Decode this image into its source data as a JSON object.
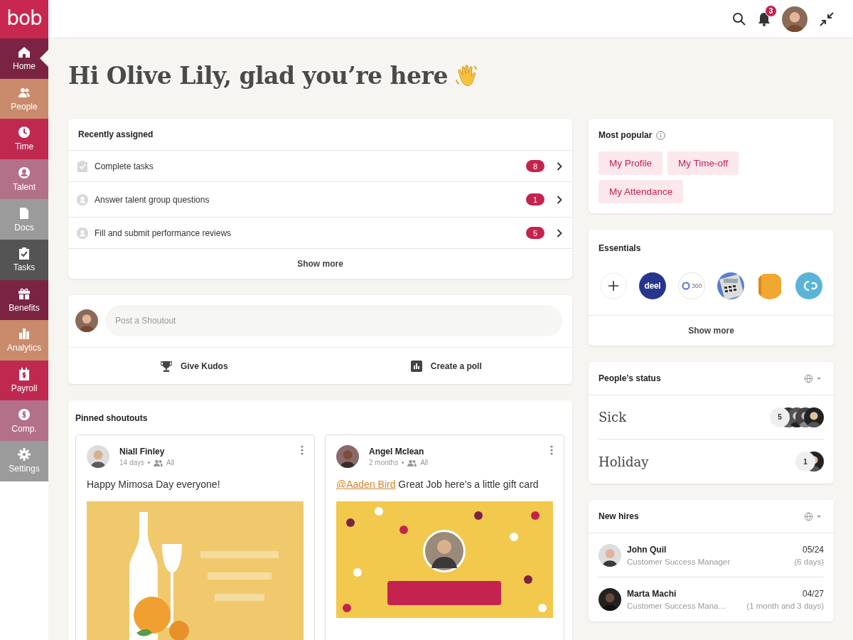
{
  "logo": "bob",
  "nav": [
    {
      "label": "Home",
      "kind": "home",
      "color": "#7b2343",
      "selected": true
    },
    {
      "label": "People",
      "kind": "people",
      "color": "#c98b6b",
      "selected": false
    },
    {
      "label": "Time",
      "kind": "clock",
      "color": "#c0294f",
      "selected": false
    },
    {
      "label": "Talent",
      "kind": "talent",
      "color": "#b37089",
      "selected": false
    },
    {
      "label": "Docs",
      "kind": "doc",
      "color": "#9b9b9b",
      "selected": false
    },
    {
      "label": "Tasks",
      "kind": "tasks",
      "color": "#545454",
      "selected": false
    },
    {
      "label": "Benefits",
      "kind": "gift",
      "color": "#7b2343",
      "selected": false
    },
    {
      "label": "Analytics",
      "kind": "chart",
      "color": "#c98b6b",
      "selected": false
    },
    {
      "label": "Payroll",
      "kind": "payroll",
      "color": "#c0294f",
      "selected": false
    },
    {
      "label": "Comp.",
      "kind": "dollar",
      "color": "#b37089",
      "selected": false
    },
    {
      "label": "Settings",
      "kind": "gear",
      "color": "#9b9b9b",
      "selected": false
    }
  ],
  "topbar": {
    "notification_count": "3"
  },
  "greeting": "Hi Olive Lily, glad you’re here",
  "recently_assigned": {
    "title": "Recently assigned",
    "items": [
      {
        "label": "Complete tasks",
        "count": "8",
        "kind": "task"
      },
      {
        "label": "Answer talent group questions",
        "count": "1",
        "kind": "talent"
      },
      {
        "label": "Fill and submit performance reviews",
        "count": "5",
        "kind": "talent"
      }
    ],
    "show_more": "Show more"
  },
  "composer": {
    "placeholder": "Post a Shoutout",
    "actions": [
      {
        "label": "Give Kudos",
        "kind": "kudos"
      },
      {
        "label": "Create a poll",
        "kind": "poll"
      }
    ]
  },
  "pinned": {
    "title": "Pinned shoutouts",
    "posts": [
      {
        "author": "Niall Finley",
        "time": "14 days",
        "audience": "All",
        "text": "Happy Mimosa Day everyone!",
        "kind": "picture"
      },
      {
        "author": "Angel Mclean",
        "time": "2 months",
        "audience": "All",
        "mention": "@Aaden Bird",
        "text": "Great Job here's a little gift card",
        "kind": "picture"
      }
    ]
  },
  "most_popular": {
    "title": "Most popular",
    "links": [
      "My Profile",
      "My Time-off",
      "My Attendance"
    ]
  },
  "essentials": {
    "title": "Essentials",
    "apps": [
      {
        "kind": "add"
      },
      {
        "kind": "deel",
        "label": "deel"
      },
      {
        "kind": "ring",
        "label": "360"
      },
      {
        "kind": "calculator"
      },
      {
        "kind": "book"
      },
      {
        "kind": "go"
      }
    ],
    "show_more": "Show more"
  },
  "peoples_status": {
    "title": "People’s status",
    "rows": [
      {
        "label": "Sick",
        "count": "5"
      },
      {
        "label": "Holiday",
        "count": "1"
      }
    ]
  },
  "new_hires": {
    "title": "New hires",
    "hires": [
      {
        "name": "John Quil",
        "role": "Customer Success Manager",
        "date": "05/24",
        "since": "(6 days)"
      },
      {
        "name": "Marta Machi",
        "role": "Customer Success Mana…",
        "date": "04/27",
        "since": "(1 month and 3 days)"
      }
    ]
  }
}
